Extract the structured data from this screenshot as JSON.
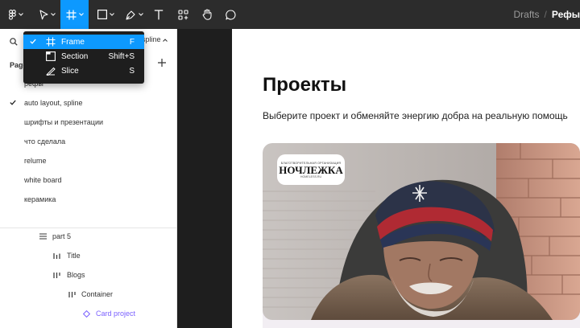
{
  "toolbar": {
    "tools": [
      {
        "name": "figma-menu",
        "icon": "figma-logo-icon"
      },
      {
        "name": "move",
        "icon": "cursor-icon"
      },
      {
        "name": "frame",
        "icon": "frame-icon",
        "active": true
      },
      {
        "name": "shape",
        "icon": "rectangle-icon"
      },
      {
        "name": "pen",
        "icon": "pen-icon"
      },
      {
        "name": "text",
        "icon": "text-icon"
      },
      {
        "name": "resources",
        "icon": "components-icon"
      },
      {
        "name": "hand",
        "icon": "hand-icon"
      },
      {
        "name": "comment",
        "icon": "comment-icon"
      }
    ],
    "breadcrumb": {
      "drafts": "Drafts",
      "separator": "/",
      "file": "Рефы"
    }
  },
  "frame_menu": {
    "items": [
      {
        "label": "Frame",
        "shortcut": "F",
        "checked": true,
        "icon": "frame-icon"
      },
      {
        "label": "Section",
        "shortcut": "Shift+S",
        "checked": false,
        "icon": "section-icon"
      },
      {
        "label": "Slice",
        "shortcut": "S",
        "checked": false,
        "icon": "slice-icon"
      }
    ]
  },
  "left_panel": {
    "current_page_tab": "spline",
    "pages_title": "Pages",
    "pages": [
      {
        "label": "рефы",
        "checked": false
      },
      {
        "label": "auto layout, spline",
        "checked": true
      },
      {
        "label": "шрифты и презентации",
        "checked": false
      },
      {
        "label": "что сделала",
        "checked": false
      },
      {
        "label": "relume",
        "checked": false
      },
      {
        "label": "white board",
        "checked": false
      },
      {
        "label": "керамика",
        "checked": false
      }
    ],
    "layers": [
      {
        "label": "part 5",
        "icon": "list-icon"
      },
      {
        "label": "Title",
        "icon": "vertical-layout-icon"
      },
      {
        "label": "Blogs",
        "icon": "vertical-layout-icon"
      },
      {
        "label": "Container",
        "icon": "vertical-layout-icon"
      },
      {
        "label": "Card project",
        "icon": "component-instance-icon"
      }
    ]
  },
  "canvas": {
    "title": "Проекты",
    "subtitle": "Выберите проект и обменяйте энергию добра на реальную помощь",
    "card_logo": {
      "top_text": "БЛАГОТВОРИТЕЛЬНАЯ ОРГАНИЗАЦИЯ",
      "name": "НОЧЛЕЖКА",
      "site": "HOMELESS.RU"
    }
  },
  "colors": {
    "accent": "#0d99ff",
    "toolbar_bg": "#2c2c2c",
    "canvas_bg": "#1e1e1e",
    "component_purple": "#7b61ff"
  }
}
